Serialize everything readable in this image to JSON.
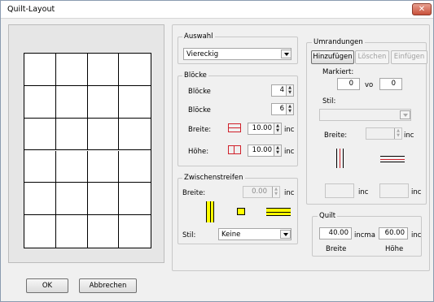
{
  "window": {
    "title": "Quilt-Layout"
  },
  "preview": {
    "columns": 4,
    "rows": 6
  },
  "auswahl": {
    "legend": "Auswahl",
    "value": "Viereckig"
  },
  "bloecke": {
    "legend": "Blöcke",
    "cols_label": "Blöcke",
    "cols_value": "4",
    "rows_label": "Blöcke",
    "rows_value": "6",
    "width_label": "Breite:",
    "width_value": "10.00",
    "width_unit": "inc",
    "height_label": "Höhe:",
    "height_value": "10.00",
    "height_unit": "inc"
  },
  "zwischen": {
    "legend": "Zwischenstreifen",
    "width_label": "Breite:",
    "width_value": "0.00",
    "width_unit": "inc",
    "stil_label": "Stil:",
    "stil_value": "Keine"
  },
  "umrandungen": {
    "legend": "Umrandungen",
    "btn_add": "Hinzufügen",
    "btn_delete": "Löschen",
    "btn_insert": "Einfügen",
    "markiert_label": "Markiert:",
    "markiert_from": "0",
    "vo_label": "vo",
    "markiert_to": "0",
    "stil_label": "Stil:",
    "width_label": "Breite:",
    "width_unit": "inc",
    "field1_unit": "inc",
    "field2_unit": "inc"
  },
  "quilt": {
    "legend": "Quilt",
    "width_value": "40.00",
    "width_unit": "incma",
    "height_value": "60.00",
    "height_unit": "inc",
    "width_caption": "Breite",
    "height_caption": "Höhe"
  },
  "footer": {
    "ok": "OK",
    "cancel": "Abbrechen"
  },
  "colors": {
    "accent_yellow": "#ffff00",
    "accent_red": "#d0202a"
  }
}
